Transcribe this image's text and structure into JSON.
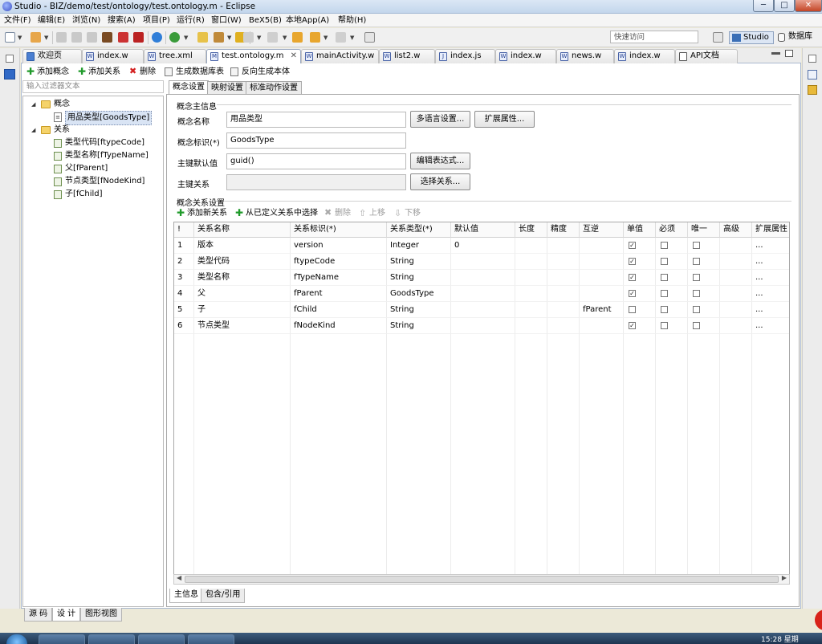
{
  "window": {
    "title": "Studio - BIZ/demo/test/ontology/test.ontology.m - Eclipse",
    "min": "─",
    "max": "□",
    "close": "✕"
  },
  "menu": [
    "文件(F)",
    "编辑(E)",
    "浏览(N)",
    "搜索(A)",
    "项目(P)",
    "运行(R)",
    "窗口(W)",
    "BeX5(B)",
    "本地App(A)",
    "帮助(H)"
  ],
  "toolbar": {
    "quick_access_placeholder": "快速访问",
    "perspective_studio": "Studio",
    "perspective_db": "数据库"
  },
  "editor_tabs": [
    {
      "label": "欢迎页",
      "icon": "welcome-icon"
    },
    {
      "label": "index.w",
      "icon": "w-file-icon"
    },
    {
      "label": "tree.xml",
      "icon": "w-file-icon"
    },
    {
      "label": "test.ontology.m",
      "icon": "m-file-icon",
      "active": true
    },
    {
      "label": "mainActivity.w",
      "icon": "w-file-icon"
    },
    {
      "label": "list2.w",
      "icon": "w-file-icon"
    },
    {
      "label": "index.js",
      "icon": "js-file-icon"
    },
    {
      "label": "index.w",
      "icon": "w-file-icon"
    },
    {
      "label": "news.w",
      "icon": "w-file-icon"
    },
    {
      "label": "index.w",
      "icon": "w-file-icon"
    },
    {
      "label": "API文档",
      "icon": "doc-icon"
    }
  ],
  "tab_close": "✕",
  "left_pane": {
    "add_concept": "添加概念",
    "add_relation": "添加关系",
    "delete": "删除",
    "filter_placeholder": "输入过滤器文本",
    "tree": {
      "concepts_folder": "概念",
      "concept_item": "用品类型[GoodsType]",
      "relations_folder": "关系",
      "relations": [
        "类型代码[ftypeCode]",
        "类型名称[fTypeName]",
        "父[fParent]",
        "节点类型[fNodeKind]",
        "子[fChild]"
      ]
    },
    "bottom_tabs": [
      "源 码",
      "设 计",
      "图形视图"
    ]
  },
  "right_pane_toolbar": {
    "gen_table": "生成数据库表",
    "reverse_gen": "反向生成本体"
  },
  "design_tabs": [
    "概念设置",
    "映射设置",
    "标准动作设置"
  ],
  "concept_info": {
    "group_title": "概念主信息",
    "name_label": "概念名称",
    "name_value": "用品类型",
    "id_label": "概念标识(*)",
    "id_value": "GoodsType",
    "default_key_label": "主键默认值",
    "default_key_value": "guid()",
    "key_relation_label": "主键关系",
    "key_relation_value": "",
    "multilang_button": "多语言设置...",
    "ext_attr_button": "扩展属性...",
    "edit_expr_button": "编辑表达式...",
    "select_rel_button": "选择关系..."
  },
  "relation_settings": {
    "group_title": "概念关系设置",
    "add_new": "添加新关系",
    "select_defined": "从已定义关系中选择",
    "delete": "删除",
    "move_up": "上移",
    "move_down": "下移",
    "columns": [
      "!",
      "关系名称",
      "关系标识(*)",
      "关系类型(*)",
      "默认值",
      "长度",
      "精度",
      "互逆",
      "单值",
      "必须",
      "唯一",
      "高级",
      "扩展属性"
    ],
    "rows": [
      {
        "no": "1",
        "name": "版本",
        "id": "version",
        "type": "Integer",
        "default": "0",
        "inverse": "",
        "single": true,
        "required": false,
        "unique": false,
        "ext": "..."
      },
      {
        "no": "2",
        "name": "类型代码",
        "id": "ftypeCode",
        "type": "String",
        "default": "",
        "inverse": "",
        "single": true,
        "required": false,
        "unique": false,
        "ext": "..."
      },
      {
        "no": "3",
        "name": "类型名称",
        "id": "fTypeName",
        "type": "String",
        "default": "",
        "inverse": "",
        "single": true,
        "required": false,
        "unique": false,
        "ext": "..."
      },
      {
        "no": "4",
        "name": "父",
        "id": "fParent",
        "type": "GoodsType",
        "default": "",
        "inverse": "",
        "single": true,
        "required": false,
        "unique": false,
        "ext": "..."
      },
      {
        "no": "5",
        "name": "子",
        "id": "fChild",
        "type": "String",
        "default": "",
        "inverse": "fParent",
        "single": false,
        "required": false,
        "unique": false,
        "ext": "..."
      },
      {
        "no": "6",
        "name": "节点类型",
        "id": "fNodeKind",
        "type": "String",
        "default": "",
        "inverse": "",
        "single": true,
        "required": false,
        "unique": false,
        "ext": "..."
      }
    ]
  },
  "detail_tabs": [
    "主信息",
    "包含/引用"
  ],
  "taskbar": {
    "clock": "15:28 星期"
  }
}
